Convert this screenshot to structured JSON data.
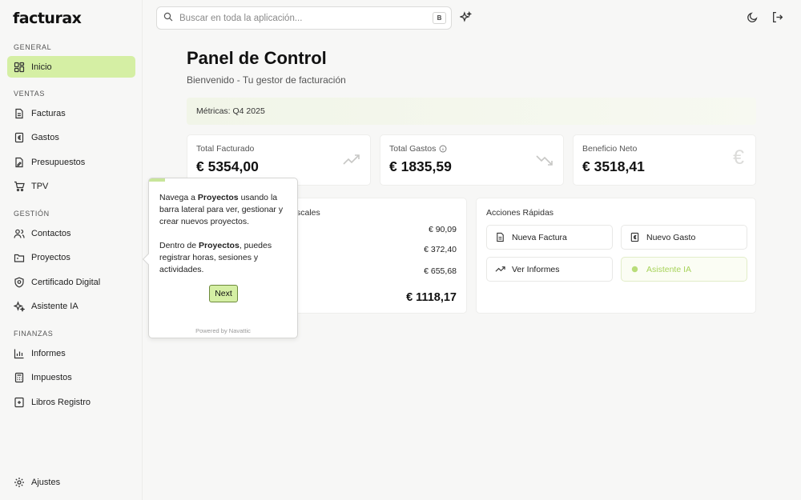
{
  "app": {
    "logo": "facturax"
  },
  "sidebar": {
    "sections": [
      {
        "label": "GENERAL",
        "items": [
          {
            "label": "Inicio",
            "icon": "grid-icon",
            "active": true
          }
        ]
      },
      {
        "label": "VENTAS",
        "items": [
          {
            "label": "Facturas",
            "icon": "invoice-icon"
          },
          {
            "label": "Gastos",
            "icon": "euro-receipt-icon"
          },
          {
            "label": "Presupuestos",
            "icon": "document-edit-icon"
          },
          {
            "label": "TPV",
            "icon": "cart-icon"
          }
        ]
      },
      {
        "label": "GESTIÓN",
        "items": [
          {
            "label": "Contactos",
            "icon": "users-icon"
          },
          {
            "label": "Proyectos",
            "icon": "folder-icon"
          },
          {
            "label": "Certificado Digital",
            "icon": "shield-icon"
          },
          {
            "label": "Asistente IA",
            "icon": "sparkles-icon"
          }
        ]
      },
      {
        "label": "FINANZAS",
        "items": [
          {
            "label": "Informes",
            "icon": "bar-chart-icon"
          },
          {
            "label": "Impuestos",
            "icon": "calculator-icon"
          },
          {
            "label": "Libros Registro",
            "icon": "book-icon"
          }
        ]
      }
    ],
    "footer": {
      "label": "Ajustes",
      "icon": "gear-icon"
    }
  },
  "search": {
    "placeholder": "Buscar en toda la aplicación...",
    "shortcut": "B"
  },
  "header": {
    "title": "Panel de Control",
    "subtitle": "Bienvenido - Tu gestor de facturación"
  },
  "metrics": {
    "label": "Métricas: Q4 2025"
  },
  "cards": [
    {
      "label": "Total Facturado",
      "value": "€ 5354,00",
      "icon": "trend-up-icon"
    },
    {
      "label": "Total Gastos",
      "value": "€ 1835,59",
      "icon": "trend-down-icon"
    },
    {
      "label": "Beneficio Neto",
      "value": "€ 3518,41",
      "icon": "euro-icon"
    }
  ],
  "taxes": {
    "title_fragment": "scales",
    "rows": [
      "€ 90,09",
      "€ 372,40",
      "€ 655,68"
    ],
    "total": "€ 1118,17"
  },
  "quick_actions": {
    "title": "Acciones Rápidas",
    "buttons": [
      {
        "label": "Nueva Factura",
        "icon": "invoice-icon"
      },
      {
        "label": "Nuevo Gasto",
        "icon": "euro-receipt-icon"
      },
      {
        "label": "Ver Informes",
        "icon": "trend-up-icon"
      },
      {
        "label": "Asistente IA",
        "icon": "sparkles-icon"
      }
    ]
  },
  "tour": {
    "p1_a": "Navega a ",
    "p1_b": "Proyectos",
    "p1_c": " usando la barra lateral para ver, gestionar y crear nuevos proyectos.",
    "p2_a": "Dentro de ",
    "p2_b": "Proyectos",
    "p2_c": ", puedes registrar horas, sesiones y actividades.",
    "next": "Next",
    "powered": "Powered by Navattic"
  },
  "colors": {
    "accent": "#d5efa4",
    "accent_border": "#6d8a3c"
  }
}
